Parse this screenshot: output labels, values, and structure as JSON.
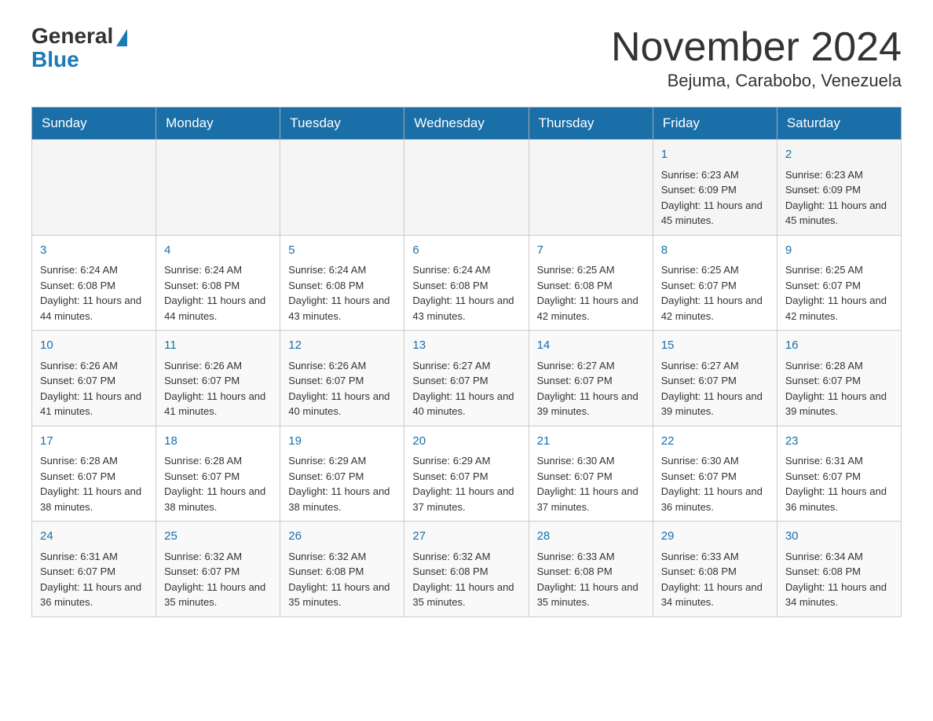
{
  "logo": {
    "general": "General",
    "blue": "Blue"
  },
  "title": "November 2024",
  "subtitle": "Bejuma, Carabobo, Venezuela",
  "days": [
    "Sunday",
    "Monday",
    "Tuesday",
    "Wednesday",
    "Thursday",
    "Friday",
    "Saturday"
  ],
  "weeks": [
    [
      {
        "num": "",
        "info": ""
      },
      {
        "num": "",
        "info": ""
      },
      {
        "num": "",
        "info": ""
      },
      {
        "num": "",
        "info": ""
      },
      {
        "num": "",
        "info": ""
      },
      {
        "num": "1",
        "info": "Sunrise: 6:23 AM\nSunset: 6:09 PM\nDaylight: 11 hours and 45 minutes."
      },
      {
        "num": "2",
        "info": "Sunrise: 6:23 AM\nSunset: 6:09 PM\nDaylight: 11 hours and 45 minutes."
      }
    ],
    [
      {
        "num": "3",
        "info": "Sunrise: 6:24 AM\nSunset: 6:08 PM\nDaylight: 11 hours and 44 minutes."
      },
      {
        "num": "4",
        "info": "Sunrise: 6:24 AM\nSunset: 6:08 PM\nDaylight: 11 hours and 44 minutes."
      },
      {
        "num": "5",
        "info": "Sunrise: 6:24 AM\nSunset: 6:08 PM\nDaylight: 11 hours and 43 minutes."
      },
      {
        "num": "6",
        "info": "Sunrise: 6:24 AM\nSunset: 6:08 PM\nDaylight: 11 hours and 43 minutes."
      },
      {
        "num": "7",
        "info": "Sunrise: 6:25 AM\nSunset: 6:08 PM\nDaylight: 11 hours and 42 minutes."
      },
      {
        "num": "8",
        "info": "Sunrise: 6:25 AM\nSunset: 6:07 PM\nDaylight: 11 hours and 42 minutes."
      },
      {
        "num": "9",
        "info": "Sunrise: 6:25 AM\nSunset: 6:07 PM\nDaylight: 11 hours and 42 minutes."
      }
    ],
    [
      {
        "num": "10",
        "info": "Sunrise: 6:26 AM\nSunset: 6:07 PM\nDaylight: 11 hours and 41 minutes."
      },
      {
        "num": "11",
        "info": "Sunrise: 6:26 AM\nSunset: 6:07 PM\nDaylight: 11 hours and 41 minutes."
      },
      {
        "num": "12",
        "info": "Sunrise: 6:26 AM\nSunset: 6:07 PM\nDaylight: 11 hours and 40 minutes."
      },
      {
        "num": "13",
        "info": "Sunrise: 6:27 AM\nSunset: 6:07 PM\nDaylight: 11 hours and 40 minutes."
      },
      {
        "num": "14",
        "info": "Sunrise: 6:27 AM\nSunset: 6:07 PM\nDaylight: 11 hours and 39 minutes."
      },
      {
        "num": "15",
        "info": "Sunrise: 6:27 AM\nSunset: 6:07 PM\nDaylight: 11 hours and 39 minutes."
      },
      {
        "num": "16",
        "info": "Sunrise: 6:28 AM\nSunset: 6:07 PM\nDaylight: 11 hours and 39 minutes."
      }
    ],
    [
      {
        "num": "17",
        "info": "Sunrise: 6:28 AM\nSunset: 6:07 PM\nDaylight: 11 hours and 38 minutes."
      },
      {
        "num": "18",
        "info": "Sunrise: 6:28 AM\nSunset: 6:07 PM\nDaylight: 11 hours and 38 minutes."
      },
      {
        "num": "19",
        "info": "Sunrise: 6:29 AM\nSunset: 6:07 PM\nDaylight: 11 hours and 38 minutes."
      },
      {
        "num": "20",
        "info": "Sunrise: 6:29 AM\nSunset: 6:07 PM\nDaylight: 11 hours and 37 minutes."
      },
      {
        "num": "21",
        "info": "Sunrise: 6:30 AM\nSunset: 6:07 PM\nDaylight: 11 hours and 37 minutes."
      },
      {
        "num": "22",
        "info": "Sunrise: 6:30 AM\nSunset: 6:07 PM\nDaylight: 11 hours and 36 minutes."
      },
      {
        "num": "23",
        "info": "Sunrise: 6:31 AM\nSunset: 6:07 PM\nDaylight: 11 hours and 36 minutes."
      }
    ],
    [
      {
        "num": "24",
        "info": "Sunrise: 6:31 AM\nSunset: 6:07 PM\nDaylight: 11 hours and 36 minutes."
      },
      {
        "num": "25",
        "info": "Sunrise: 6:32 AM\nSunset: 6:07 PM\nDaylight: 11 hours and 35 minutes."
      },
      {
        "num": "26",
        "info": "Sunrise: 6:32 AM\nSunset: 6:08 PM\nDaylight: 11 hours and 35 minutes."
      },
      {
        "num": "27",
        "info": "Sunrise: 6:32 AM\nSunset: 6:08 PM\nDaylight: 11 hours and 35 minutes."
      },
      {
        "num": "28",
        "info": "Sunrise: 6:33 AM\nSunset: 6:08 PM\nDaylight: 11 hours and 35 minutes."
      },
      {
        "num": "29",
        "info": "Sunrise: 6:33 AM\nSunset: 6:08 PM\nDaylight: 11 hours and 34 minutes."
      },
      {
        "num": "30",
        "info": "Sunrise: 6:34 AM\nSunset: 6:08 PM\nDaylight: 11 hours and 34 minutes."
      }
    ]
  ]
}
